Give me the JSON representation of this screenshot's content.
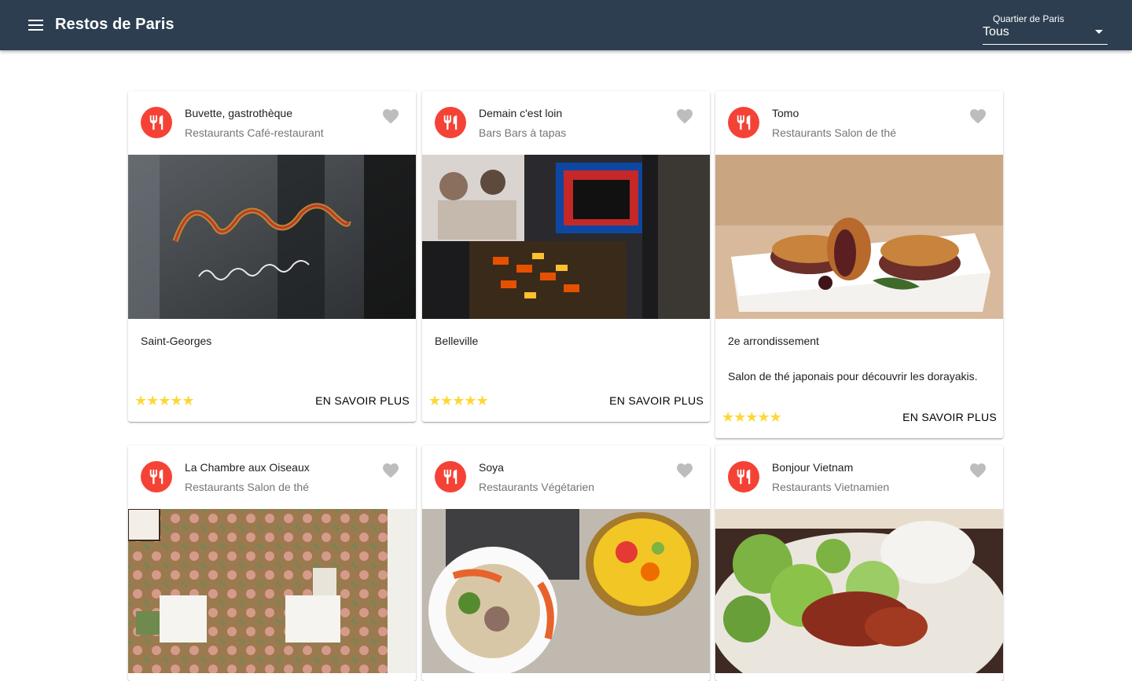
{
  "header": {
    "title": "Restos de Paris",
    "select_label": "Quartier de Paris",
    "select_value": "Tous"
  },
  "colors": {
    "appbar": "#2c3e50",
    "avatar": "#f44336",
    "star": "#fdd835",
    "heart": "#bdbdbd"
  },
  "cards": [
    {
      "title": "Buvette, gastrothèque",
      "subtitle": "Restaurants Café-restaurant",
      "quartier": "Saint-Georges",
      "description": "",
      "rating": "★★★★★",
      "action": "EN SAVOIR PLUS",
      "icon": "restaurant-icon"
    },
    {
      "title": "Demain c'est loin",
      "subtitle": "Bars Bars à tapas",
      "quartier": "Belleville",
      "description": "",
      "rating": "★★★★★",
      "action": "EN SAVOIR PLUS",
      "icon": "restaurant-icon"
    },
    {
      "title": "Tomo",
      "subtitle": "Restaurants Salon de thé",
      "quartier": "2e arrondissement",
      "description": "Salon de thé japonais pour découvrir les dorayakis.",
      "rating": "★★★★★",
      "action": "EN SAVOIR PLUS",
      "icon": "restaurant-icon"
    },
    {
      "title": "La Chambre aux Oiseaux",
      "subtitle": "Restaurants Salon de thé",
      "quartier": "",
      "description": "",
      "rating": "",
      "action": "",
      "icon": "restaurant-icon"
    },
    {
      "title": "Soya",
      "subtitle": "Restaurants Végétarien",
      "quartier": "",
      "description": "",
      "rating": "",
      "action": "",
      "icon": "restaurant-icon"
    },
    {
      "title": "Bonjour Vietnam",
      "subtitle": "Restaurants Vietnamien",
      "quartier": "",
      "description": "",
      "rating": "",
      "action": "",
      "icon": "restaurant-icon"
    }
  ]
}
